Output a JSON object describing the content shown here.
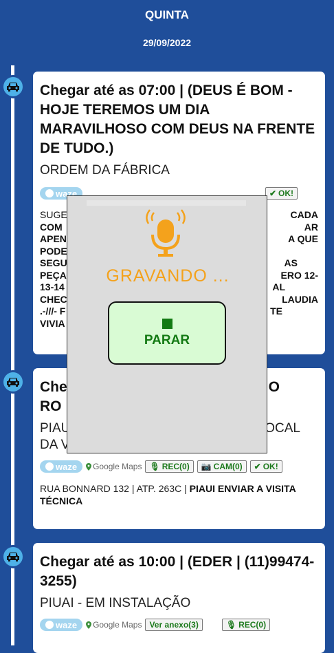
{
  "header": {
    "day": "QUINTA",
    "date": "29/09/2022"
  },
  "cards": [
    {
      "title": "Chegar até as 07:00 | (DEUS É BOM - HOJE TEREMOS UM DIA MARAVILHOSO COM DEUS NA FRENTE DE TUDO.)",
      "subtitle": "ORDEM DA FÁBRICA",
      "waze_label": "waze",
      "ok_label": "OK!",
      "visible_lines": [
        {
          "left": "SUGE",
          "right": "CADA"
        },
        {
          "left": "COM",
          "right": "AR"
        },
        {
          "left": "APEN",
          "right": "A QUE"
        },
        {
          "left": "PODE",
          "right": ""
        },
        {
          "left": "SEGU",
          "right": "AS"
        },
        {
          "left": "PEÇA",
          "right": "ERO 12-"
        },
        {
          "left": "13-14",
          "right": "AL"
        },
        {
          "left": "CHEC",
          "right": "LAUDIA"
        },
        {
          "left": ".-///- F",
          "right": "TE"
        },
        {
          "left": "VIVIA",
          "right": ""
        }
      ]
    },
    {
      "title_visible_left": "Che",
      "title_visible_right": "O",
      "title_line2_left": "RO",
      "subtitle_left": "PIAU",
      "subtitle_right": "OCAL",
      "subtitle_line2": "DA VISITA TÉCNICA",
      "waze_label": "waze",
      "gmaps_label": "Google Maps",
      "rec_label": "REC(0)",
      "cam_label": "CAM(0)",
      "ok_label": "OK!",
      "address": "RUA BONNARD 132 | ATP. 263C |",
      "address_bold": "PIAUI ENVIAR A VISITA TÉCNICA"
    },
    {
      "title": "Chegar até as 10:00 | (EDER | (11)99474-3255)",
      "subtitle": "PIUAI - EM INSTALAÇÃO",
      "waze_label": "waze",
      "gmaps_label": "Google Maps",
      "anexo_label": "Ver anexo(3)",
      "rec_label": "REC(0)"
    }
  ],
  "recorder": {
    "status_text": "GRAVANDO ...",
    "stop_label": "PARAR",
    "mic_icon": "microphone-icon",
    "accent": "#f4a21c"
  },
  "colors": {
    "background": "#1f4e9a",
    "bubble": "#4eb1e8",
    "action_green": "#1d7a1d"
  }
}
